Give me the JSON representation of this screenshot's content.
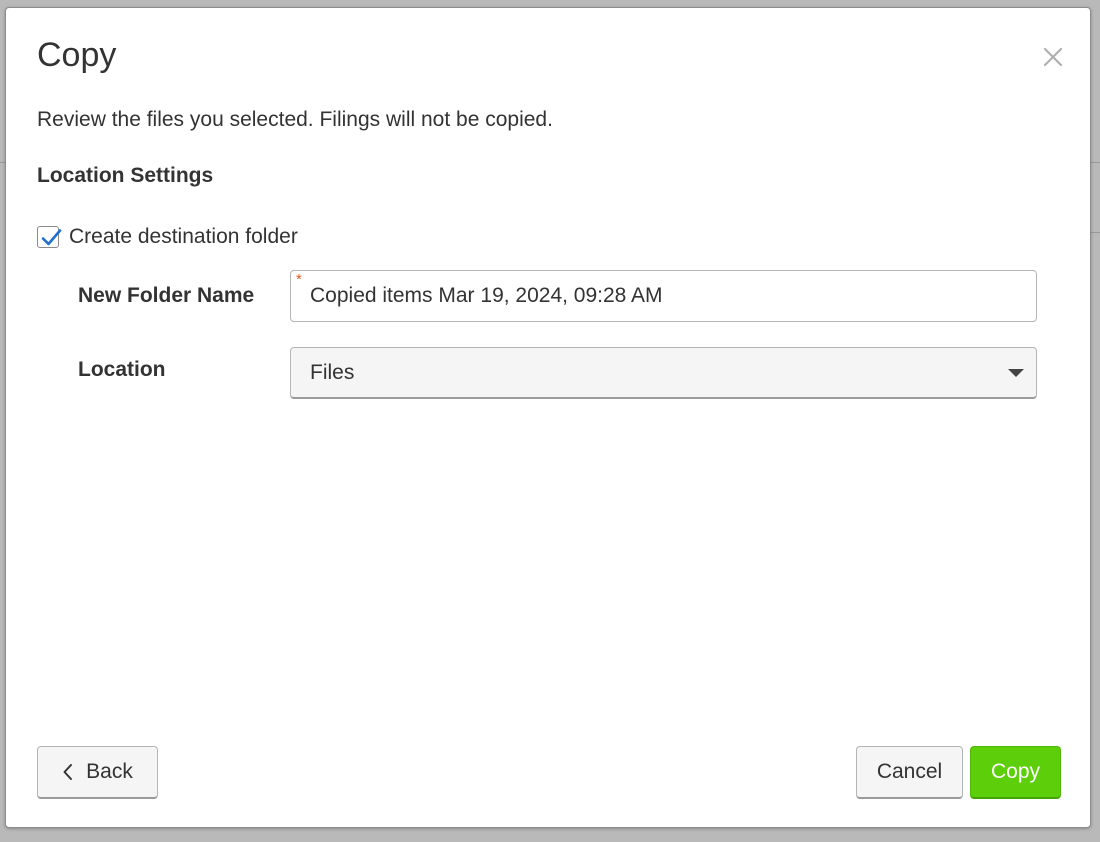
{
  "dialog": {
    "title": "Copy",
    "description": "Review the files you selected. Filings will not be copied."
  },
  "location_settings": {
    "heading": "Location Settings",
    "create_folder": {
      "label": "Create destination folder",
      "checked": true
    },
    "new_folder_name": {
      "label": "New Folder Name",
      "required_marker": "*",
      "value": "Copied items Mar 19, 2024, 09:28 AM"
    },
    "location": {
      "label": "Location",
      "selected": "Files"
    }
  },
  "footer": {
    "back_label": "Back",
    "cancel_label": "Cancel",
    "copy_label": "Copy"
  },
  "colors": {
    "primary_button": "#5ccf0a",
    "checkmark": "#1f6fd1",
    "required_star": "#e35b1e",
    "text": "#333333"
  },
  "icons": {
    "close": "close-icon",
    "checkmark": "checkmark-icon",
    "dropdown": "caret-down-icon",
    "back": "chevron-left-icon"
  }
}
